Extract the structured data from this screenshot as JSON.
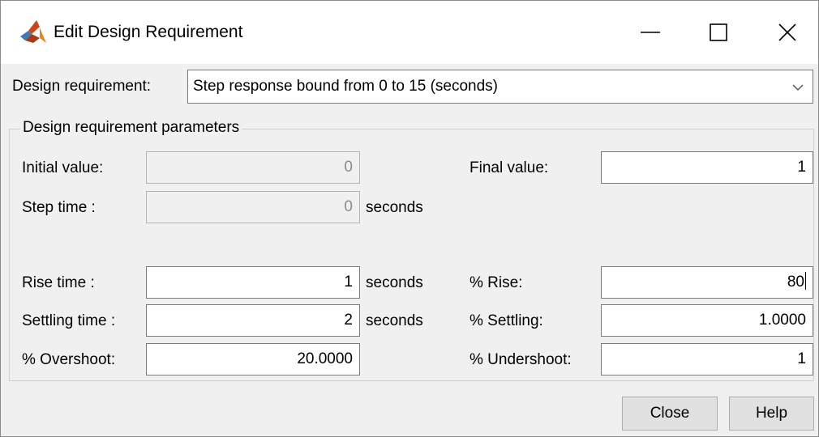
{
  "window": {
    "title": "Edit Design Requirement",
    "icon": "matlab-logo-icon"
  },
  "controls": {
    "minimize_icon": "minimize-icon",
    "maximize_icon": "maximize-icon",
    "close_icon": "close-icon"
  },
  "requirement": {
    "label": "Design requirement:",
    "selected": "Step response bound from 0 to 15 (seconds)",
    "dropdown_icon": "chevron-down-icon"
  },
  "parameters": {
    "group_title": "Design requirement parameters",
    "initial_value": {
      "label": "Initial value:",
      "value": "0",
      "enabled": false
    },
    "final_value": {
      "label": "Final value:",
      "value": "1",
      "enabled": true
    },
    "step_time": {
      "label": "Step time :",
      "value": "0",
      "unit": "seconds",
      "enabled": false
    },
    "rise_time": {
      "label": "Rise time :",
      "value": "1",
      "unit": "seconds",
      "enabled": true
    },
    "percent_rise": {
      "label": "% Rise:",
      "value": "80",
      "enabled": true,
      "focused": true
    },
    "settling_time": {
      "label": "Settling time :",
      "value": "2",
      "unit": "seconds",
      "enabled": true
    },
    "percent_settling": {
      "label": "% Settling:",
      "value": "1.0000",
      "enabled": true
    },
    "percent_overshoot": {
      "label": "% Overshoot:",
      "value": "20.0000",
      "enabled": true
    },
    "percent_undershoot": {
      "label": "% Undershoot:",
      "value": "1",
      "enabled": true
    }
  },
  "buttons": {
    "close_label": "Close",
    "help_label": "Help"
  },
  "colors": {
    "window_bg": "#f0f0f0",
    "titlebar_bg": "#ffffff",
    "field_border": "#7a7a7a",
    "disabled_text": "#8a8a8a",
    "button_bg": "#e1e1e1"
  }
}
